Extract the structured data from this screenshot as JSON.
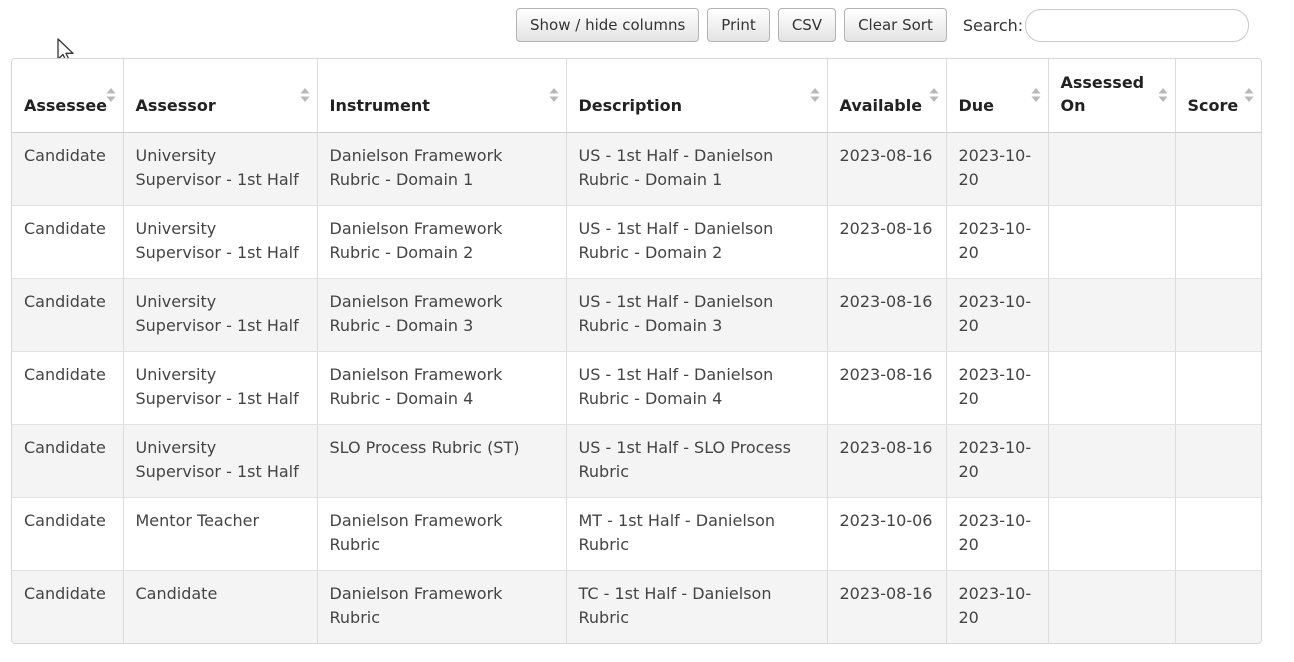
{
  "toolbar": {
    "show_hide_label": "Show / hide columns",
    "print_label": "Print",
    "csv_label": "CSV",
    "clear_sort_label": "Clear Sort",
    "search_label": "Search:",
    "search_value": ""
  },
  "table": {
    "headers": [
      "Assessee",
      "Assessor",
      "Instrument",
      "Description",
      "Available",
      "Due",
      "Assessed On",
      "Score"
    ],
    "rows": [
      [
        "Candidate",
        "University Supervisor - 1st Half",
        "Danielson Framework Rubric - Domain 1",
        "US - 1st Half - Danielson Rubric - Domain 1",
        "2023-08-16",
        "2023-10-20",
        "",
        ""
      ],
      [
        "Candidate",
        "University Supervisor - 1st Half",
        "Danielson Framework Rubric - Domain 2",
        "US - 1st Half - Danielson Rubric - Domain 2",
        "2023-08-16",
        "2023-10-20",
        "",
        ""
      ],
      [
        "Candidate",
        "University Supervisor - 1st Half",
        "Danielson Framework Rubric - Domain 3",
        "US - 1st Half - Danielson Rubric - Domain 3",
        "2023-08-16",
        "2023-10-20",
        "",
        ""
      ],
      [
        "Candidate",
        "University Supervisor - 1st Half",
        "Danielson Framework Rubric - Domain 4",
        "US - 1st Half - Danielson Rubric - Domain 4",
        "2023-08-16",
        "2023-10-20",
        "",
        ""
      ],
      [
        "Candidate",
        "University Supervisor - 1st Half",
        "SLO Process Rubric (ST)",
        "US - 1st Half - SLO Process Rubric",
        "2023-08-16",
        "2023-10-20",
        "",
        ""
      ],
      [
        "Candidate",
        "Mentor Teacher",
        "Danielson Framework Rubric",
        "MT - 1st Half - Danielson Rubric",
        "2023-10-06",
        "2023-10-20",
        "",
        ""
      ],
      [
        "Candidate",
        "Candidate",
        "Danielson Framework Rubric",
        "TC - 1st Half - Danielson Rubric",
        "2023-08-16",
        "2023-10-20",
        "",
        ""
      ]
    ]
  },
  "icons": {
    "sort": "sort-both-icon",
    "cursor": "mouse-pointer-icon"
  },
  "colors": {
    "row_stripe": "#f4f4f4",
    "border": "#d6d6d6",
    "sort_icon": "#b8b8b8"
  }
}
